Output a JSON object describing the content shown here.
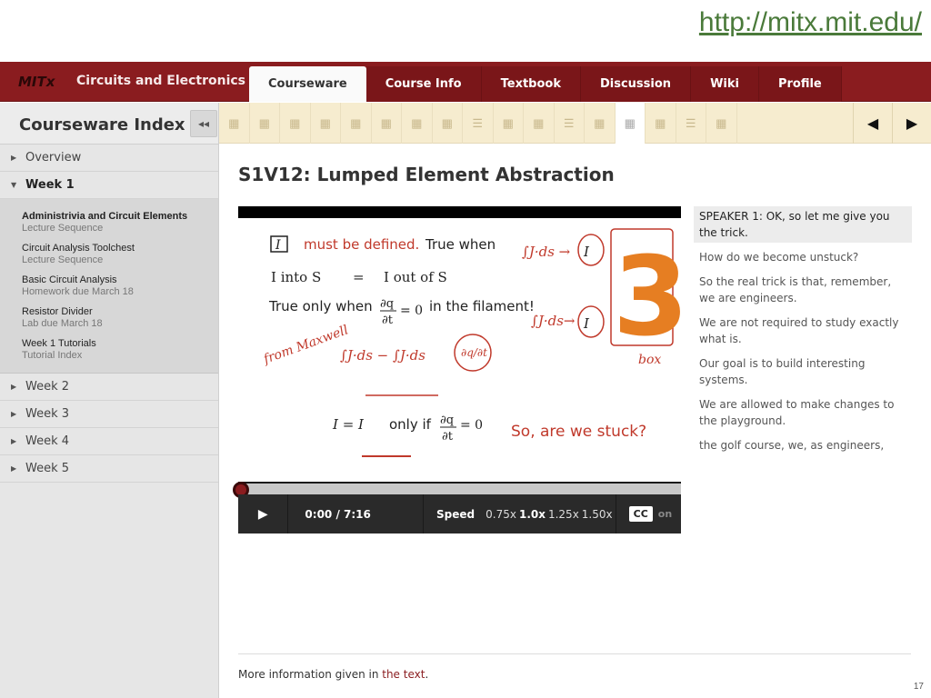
{
  "url": "http://mitx.mit.edu/",
  "header": {
    "brand": "MITx",
    "course": "Circuits and Electronics",
    "tabs": [
      {
        "label": "Courseware",
        "active": true
      },
      {
        "label": "Course Info"
      },
      {
        "label": "Textbook"
      },
      {
        "label": "Discussion"
      },
      {
        "label": "Wiki"
      },
      {
        "label": "Profile"
      }
    ],
    "brand_color": "#8a1c1f"
  },
  "sidebar": {
    "title": "Courseware Index",
    "collapse_glyph": "◂◂",
    "weeks": [
      {
        "label": "Overview"
      },
      {
        "label": "Week 1",
        "open": true
      },
      {
        "label": "Week 2"
      },
      {
        "label": "Week 3"
      },
      {
        "label": "Week 4"
      },
      {
        "label": "Week 5"
      }
    ],
    "week1_items": [
      {
        "title": "Administrivia and Circuit Elements",
        "sub": "Lecture Sequence"
      },
      {
        "title": "Circuit Analysis Toolchest",
        "sub": "Lecture Sequence"
      },
      {
        "title": "Basic Circuit Analysis",
        "sub": "Homework due March 18"
      },
      {
        "title": "Resistor Divider",
        "sub": "Lab due March 18"
      },
      {
        "title": "Week 1 Tutorials",
        "sub": "Tutorial Index"
      }
    ]
  },
  "sequence": {
    "icons": [
      "video-icon",
      "video-icon",
      "video-icon",
      "video-icon",
      "video-icon",
      "video-icon",
      "video-icon",
      "video-icon",
      "list-icon",
      "video-icon",
      "video-icon",
      "list-icon",
      "video-icon",
      "video-icon",
      "video-icon",
      "list-icon",
      "video-icon"
    ],
    "active_index": 13,
    "prev_glyph": "◀",
    "next_glyph": "▶"
  },
  "unit": {
    "title": "S1V12: Lumped Element Abstraction"
  },
  "player": {
    "time": "0:00 / 7:16",
    "speed_label": "Speed",
    "speeds": [
      "0.75x",
      "1.0x",
      "1.25x",
      "1.50x"
    ],
    "active_speed": "1.0x",
    "cc_label": "CC",
    "cc_state": "on",
    "progress": 0
  },
  "slide": {
    "box_label": "I",
    "defined_text": "must be defined.",
    "true_when": "True when",
    "line2": "I  into S",
    "eq": "=",
    "line2b": "I  out of S",
    "true_only": "True only when",
    "in_filament": "in the filament!",
    "from_maxwell": "from Maxwell",
    "only_if": "only if",
    "stuck": "So, are we stuck?",
    "big_number": "3",
    "box_word": "box"
  },
  "transcript": [
    {
      "text": "SPEAKER 1: OK, so let me give you the trick.",
      "current": true
    },
    {
      "text": "How do we become unstuck?"
    },
    {
      "text": "So the real trick is that, remember, we are engineers."
    },
    {
      "text": "We are not required to study exactly what is."
    },
    {
      "text": "Our goal is to build interesting systems."
    },
    {
      "text": "We are allowed to make changes to the playground."
    },
    {
      "text": "the golf course, we, as engineers,"
    }
  ],
  "footer": {
    "more_prefix": "More information given in ",
    "more_link": "the text",
    "more_suffix": "."
  },
  "slide_number": "17"
}
